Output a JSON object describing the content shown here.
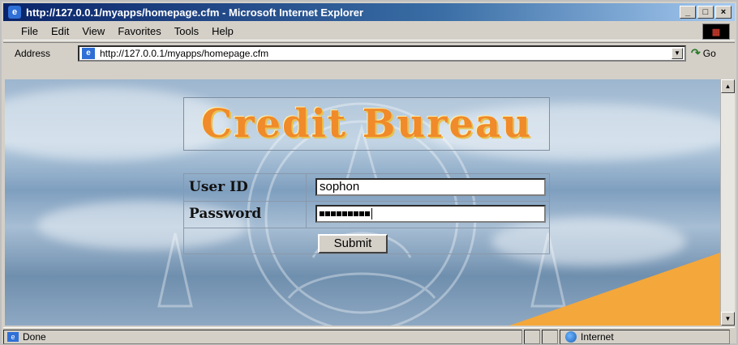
{
  "window": {
    "title": "http://127.0.0.1/myapps/homepage.cfm - Microsoft Internet Explorer",
    "controls": {
      "minimize": "_",
      "maximize": "□",
      "close": "×"
    }
  },
  "menu": {
    "items": [
      "File",
      "Edit",
      "View",
      "Favorites",
      "Tools",
      "Help"
    ]
  },
  "address": {
    "label": "Address",
    "url": "http://127.0.0.1/myapps/homepage.cfm",
    "go_label": "Go"
  },
  "page": {
    "logo_text": "Credit Bureau",
    "user_id_label": "User ID",
    "password_label": "Password",
    "user_id_value": "sophon",
    "password_mask_length": 9,
    "submit_label": "Submit"
  },
  "status": {
    "left_text": "Done",
    "zone_text": "Internet"
  },
  "colors": {
    "title_bar_start": "#0a246a",
    "logo_orange": "#f08a2a",
    "wedge_orange": "#f4a73b",
    "sky": "#9db6cf"
  },
  "icons": [
    "ie-page-icon",
    "windows-logo-icon",
    "go-arrow-icon",
    "internet-globe-icon",
    "scroll-up-icon",
    "scroll-down-icon",
    "dropdown-arrow-icon"
  ]
}
